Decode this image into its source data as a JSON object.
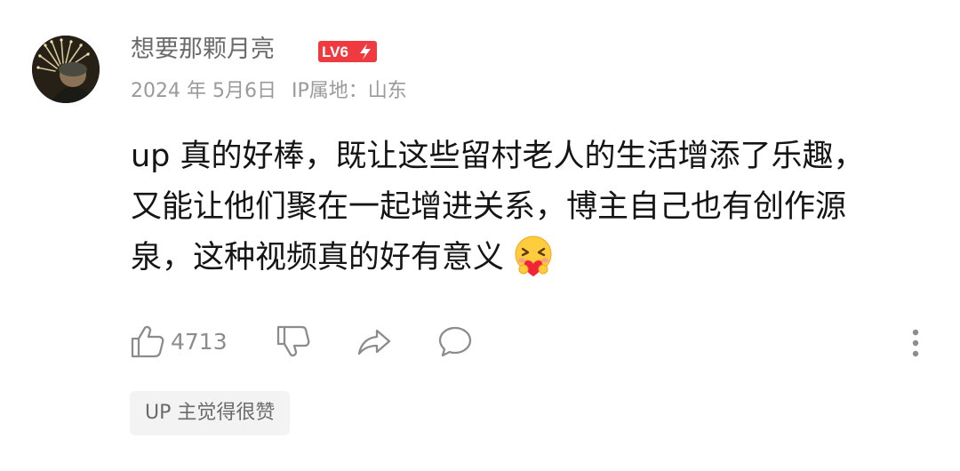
{
  "comment": {
    "username": "想要那颗月亮",
    "level_badge": "LV6",
    "date": "2024 年 5月6日",
    "ip_location": "IP属地：山东",
    "content_lines": [
      "up 真的好棒，既让这些留村老人的生活增添了乐趣，",
      "又能让他们聚在一起增进关系，博主自己也有创作源",
      "泉，这种视频真的好有意义"
    ],
    "emoji_icon": "hugging-heart-emoji-icon",
    "like_count": "4713",
    "up_liked_label": "UP 主觉得很赞"
  },
  "icons": {
    "like": "thumbs-up-icon",
    "dislike": "thumbs-down-icon",
    "share": "share-arrow-icon",
    "reply": "comment-bubble-icon",
    "more": "more-vertical-icon"
  },
  "colors": {
    "level_badge": "#ef3b40",
    "text_primary": "#151515",
    "text_secondary": "#9a9a9a",
    "username": "#6b6b6b",
    "tag_bg": "#f3f3f3"
  }
}
